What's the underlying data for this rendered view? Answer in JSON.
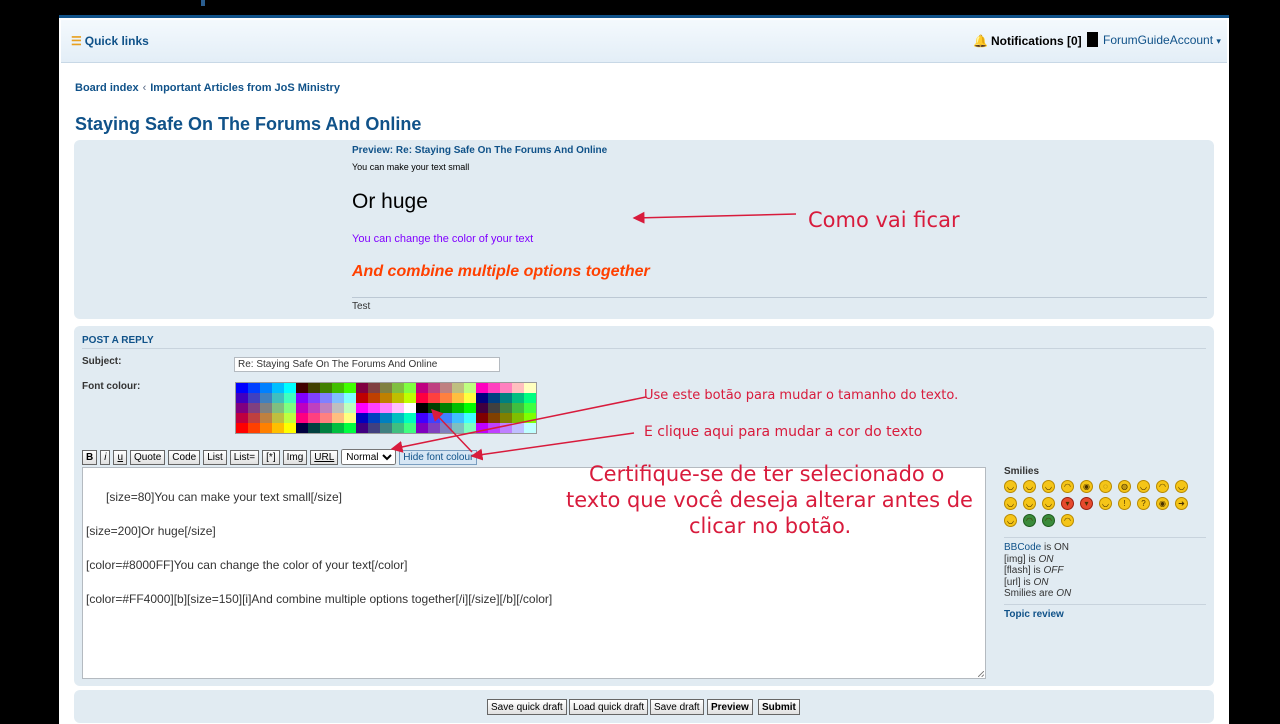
{
  "navbar": {
    "quick_links": "Quick links",
    "notifications": "Notifications [0]",
    "account": "ForumGuideAccount",
    "account_caret": "▾"
  },
  "breadcrumbs": [
    "Board index",
    "Important Articles from JoS Ministry"
  ],
  "topic_title": "Staying Safe On The Forums And Online",
  "preview": {
    "title": "Preview: Re: Staying Safe On The Forums And Online",
    "line_small": "You can make your text small",
    "line_huge": "Or huge",
    "line_color": "You can change the color of your text",
    "line_combined": "And combine multiple options together",
    "signature": "Test"
  },
  "reply": {
    "heading": "POST A REPLY",
    "subject_label": "Subject:",
    "subject_value": "Re: Staying Safe On The Forums And Online",
    "font_colour_label": "Font colour:",
    "toolbar": {
      "bold": "B",
      "italic": "i",
      "underline": "u",
      "quote": "Quote",
      "code": "Code",
      "list": "List",
      "list_num": "List=",
      "list_item": "[*]",
      "img": "Img",
      "url": "URL",
      "size_selected": "Normal",
      "hide_colour": "Hide font colour"
    },
    "message": "[size=80]You can make your text small[/size]\n\n[size=200]Or huge[/size]\n\n[color=#8000FF]You can change the color of your text[/color]\n\n[color=#FF4000][b][size=150][i]And combine multiple options together[/i][/size][/b][/color]"
  },
  "sidebar": {
    "smilies_title": "Smilies",
    "bbcode_link": "BBCode",
    "bbcode_state": " is ON",
    "img_text": "[img] is ",
    "img_state": "ON",
    "flash_text": "[flash] is ",
    "flash_state": "OFF",
    "url_text": "[url] is ",
    "url_state": "ON",
    "smilies_text": "Smilies are ",
    "smilies_state": "ON",
    "topic_review": "Topic review"
  },
  "actions": {
    "save_quick_draft": "Save quick draft",
    "load_quick_draft": "Load quick draft",
    "save_draft": "Save draft",
    "preview": "Preview",
    "submit": "Submit"
  },
  "annotations": {
    "preview_note": "Como vai ficar",
    "size_note": "Use este botão para mudar o tamanho do texto.",
    "color_note": "E clique aqui para mudar a cor do texto",
    "select_note_1": "Certifique-se de ter selecionado o",
    "select_note_2": "texto que você deseja alterar antes de",
    "select_note_3": "clicar no botão.",
    "annotation_color": "#d81b3c"
  },
  "colors": {
    "accent": "#105289",
    "panel": "#e1ebf2",
    "preview_purple": "#8000FF",
    "preview_orange": "#FF4000"
  }
}
